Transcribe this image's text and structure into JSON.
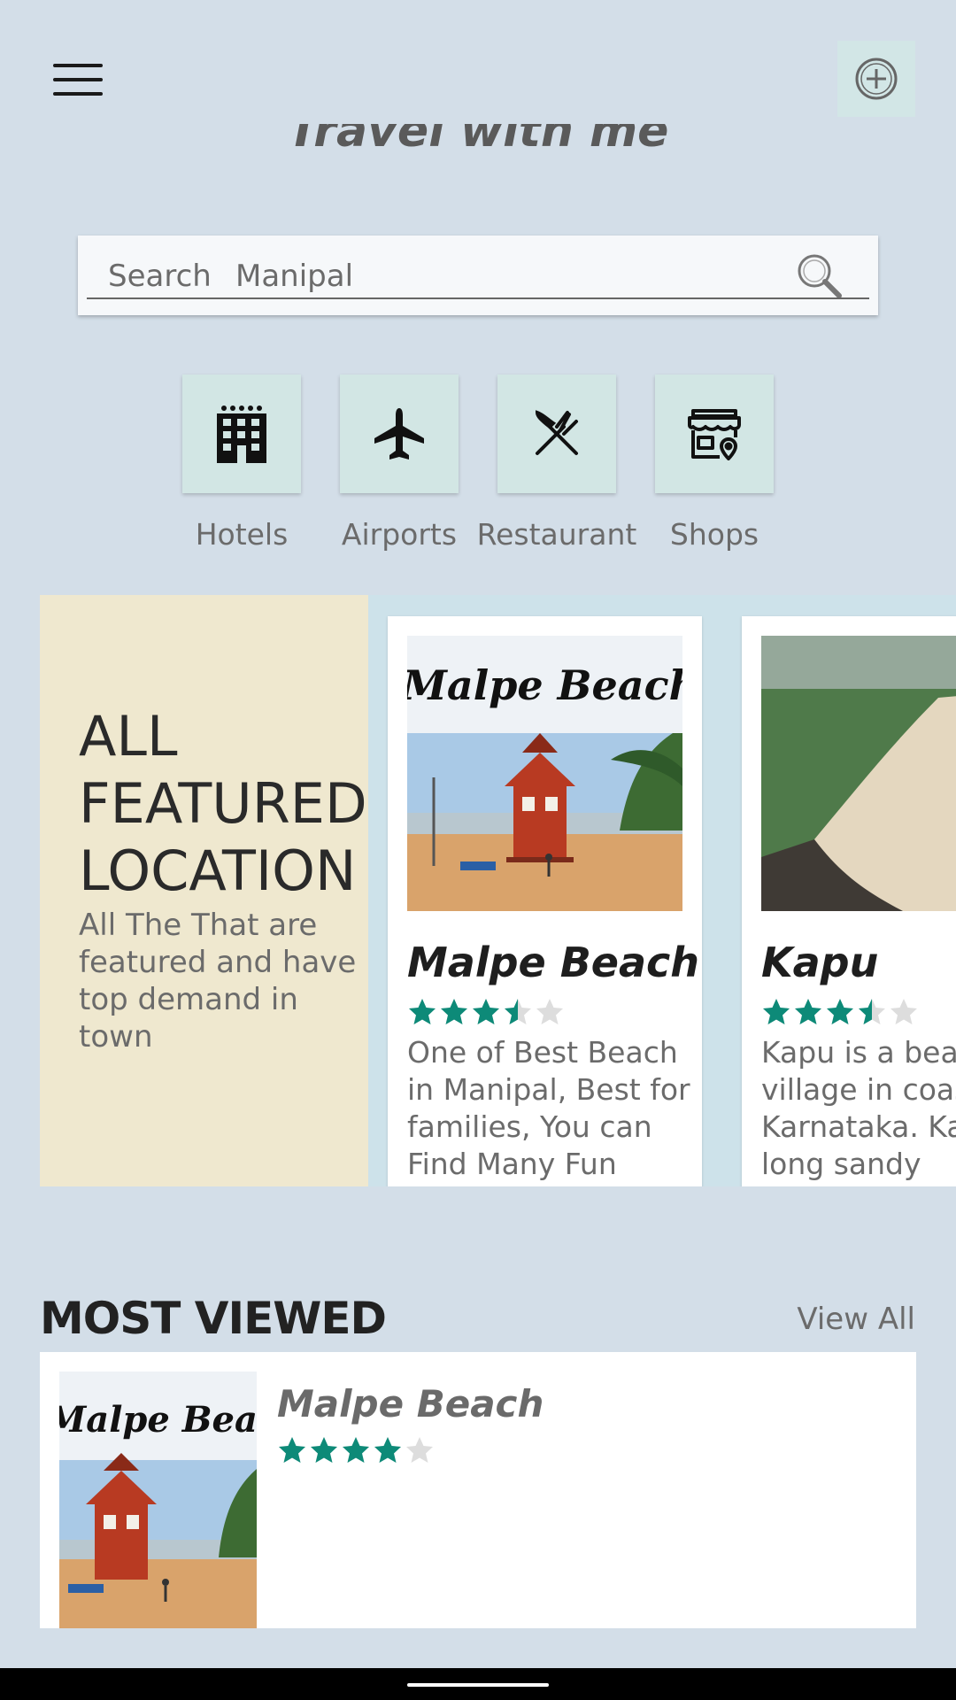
{
  "header": {
    "title": "Travel with me",
    "menu_icon": "hamburger-menu-icon",
    "add_icon": "add-circle-icon"
  },
  "search": {
    "label": "Search",
    "value": "Manipal",
    "icon": "search-icon"
  },
  "categories": [
    {
      "label": "Hotels",
      "icon": "hotel-building-icon"
    },
    {
      "label": "Airports",
      "icon": "airplane-icon"
    },
    {
      "label": "Restaurant",
      "icon": "fork-knife-icon"
    },
    {
      "label": "Shops",
      "icon": "shop-icon"
    }
  ],
  "featured": {
    "title": "ALL FEATURED LOCATION",
    "description": "All The That are featured and have top demand in town",
    "cards": [
      {
        "image_caption": "Malpe Beach Udupi",
        "title": "Malpe Beach",
        "rating": 3.5,
        "description": "One of Best Beach in Manipal, Best for families, You can Find Many Fun Activities Here Like"
      },
      {
        "title": "Kapu",
        "rating": 3.5,
        "description": "Kapu is a beach village in coastal Karnataka. Kapu long sandy beaches offer"
      }
    ]
  },
  "most_viewed": {
    "title": "MOST VIEWED",
    "view_all": "View All",
    "items": [
      {
        "image_caption": "Malpe Beach Udupi",
        "name": "Malpe Beach",
        "rating": 4
      }
    ]
  },
  "colors": {
    "background": "#d3dee8",
    "star": "#0d8a78",
    "star_empty": "#dddddd",
    "category_bg": "#d2e6e4",
    "featured_panel": "#efe8cf"
  }
}
